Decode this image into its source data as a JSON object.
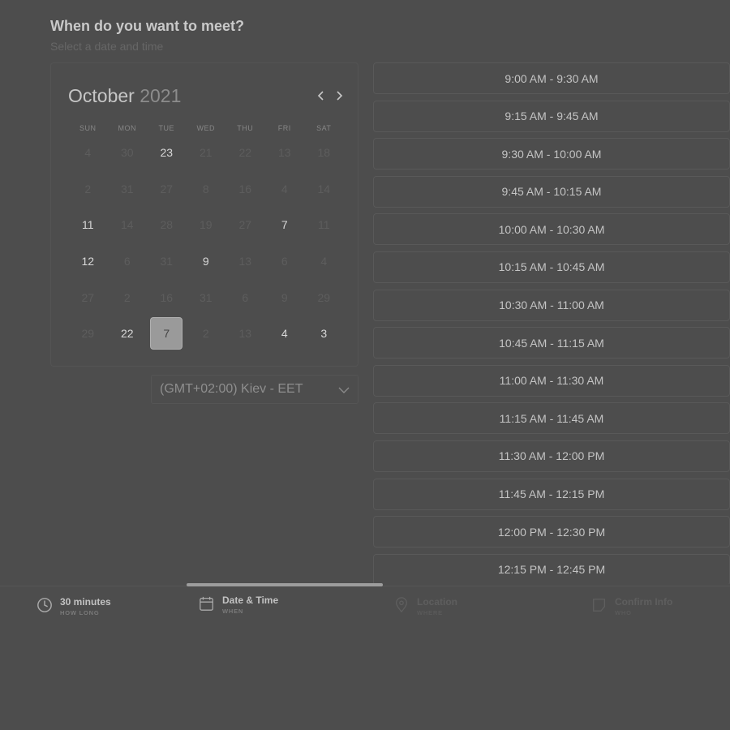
{
  "header": {
    "title": "When do you want to meet?",
    "subtitle": "Select a date and time"
  },
  "calendar": {
    "month": "October",
    "year": "2021",
    "weekdays": [
      "SUN",
      "MON",
      "TUE",
      "WED",
      "THU",
      "FRI",
      "SAT"
    ],
    "days": [
      {
        "n": "4",
        "available": false
      },
      {
        "n": "30",
        "available": false
      },
      {
        "n": "23",
        "available": true
      },
      {
        "n": "21",
        "available": false
      },
      {
        "n": "22",
        "available": false
      },
      {
        "n": "13",
        "available": false
      },
      {
        "n": "18",
        "available": false
      },
      {
        "n": "2",
        "available": false
      },
      {
        "n": "31",
        "available": false
      },
      {
        "n": "27",
        "available": false
      },
      {
        "n": "8",
        "available": false
      },
      {
        "n": "16",
        "available": false
      },
      {
        "n": "4",
        "available": false
      },
      {
        "n": "14",
        "available": false
      },
      {
        "n": "11",
        "available": true
      },
      {
        "n": "14",
        "available": false
      },
      {
        "n": "28",
        "available": false
      },
      {
        "n": "19",
        "available": false
      },
      {
        "n": "27",
        "available": false
      },
      {
        "n": "7",
        "available": true
      },
      {
        "n": "11",
        "available": false
      },
      {
        "n": "12",
        "available": true
      },
      {
        "n": "6",
        "available": false
      },
      {
        "n": "31",
        "available": false
      },
      {
        "n": "9",
        "available": true
      },
      {
        "n": "13",
        "available": false
      },
      {
        "n": "6",
        "available": false
      },
      {
        "n": "4",
        "available": false
      },
      {
        "n": "27",
        "available": false
      },
      {
        "n": "2",
        "available": false
      },
      {
        "n": "16",
        "available": false
      },
      {
        "n": "31",
        "available": false
      },
      {
        "n": "6",
        "available": false
      },
      {
        "n": "9",
        "available": false
      },
      {
        "n": "29",
        "available": false
      },
      {
        "n": "29",
        "available": false
      },
      {
        "n": "22",
        "available": true
      },
      {
        "n": "7",
        "available": true,
        "selected": true
      },
      {
        "n": "2",
        "available": false
      },
      {
        "n": "13",
        "available": false
      },
      {
        "n": "4",
        "available": true
      },
      {
        "n": "3",
        "available": true
      }
    ],
    "prev_icon": "chevron-left-icon",
    "next_icon": "chevron-right-icon"
  },
  "timezone": {
    "value": "(GMT+02:00) Kiev - EET",
    "icon": "chevron-down-icon"
  },
  "time_slots": [
    "9:00 AM - 9:30 AM",
    "9:15 AM - 9:45 AM",
    "9:30 AM - 10:00 AM",
    "9:45 AM - 10:15 AM",
    "10:00 AM - 10:30 AM",
    "10:15 AM - 10:45 AM",
    "10:30 AM - 11:00 AM",
    "10:45 AM - 11:15 AM",
    "11:00 AM - 11:30 AM",
    "11:15 AM - 11:45 AM",
    "11:30 AM - 12:00 PM",
    "11:45 AM - 12:15 PM",
    "12:00 PM - 12:30 PM",
    "12:15 PM - 12:45 PM"
  ],
  "steps": [
    {
      "label": "30 minutes",
      "sub": "HOW LONG",
      "icon": "clock-icon",
      "state": "done"
    },
    {
      "label": "Date & Time",
      "sub": "WHEN",
      "icon": "calendar-icon",
      "state": "active"
    },
    {
      "label": "Location",
      "sub": "WHERE",
      "icon": "map-pin-icon",
      "state": "pending"
    },
    {
      "label": "Confirm Info",
      "sub": "WHO",
      "icon": "checkbox-icon",
      "state": "pending"
    }
  ]
}
